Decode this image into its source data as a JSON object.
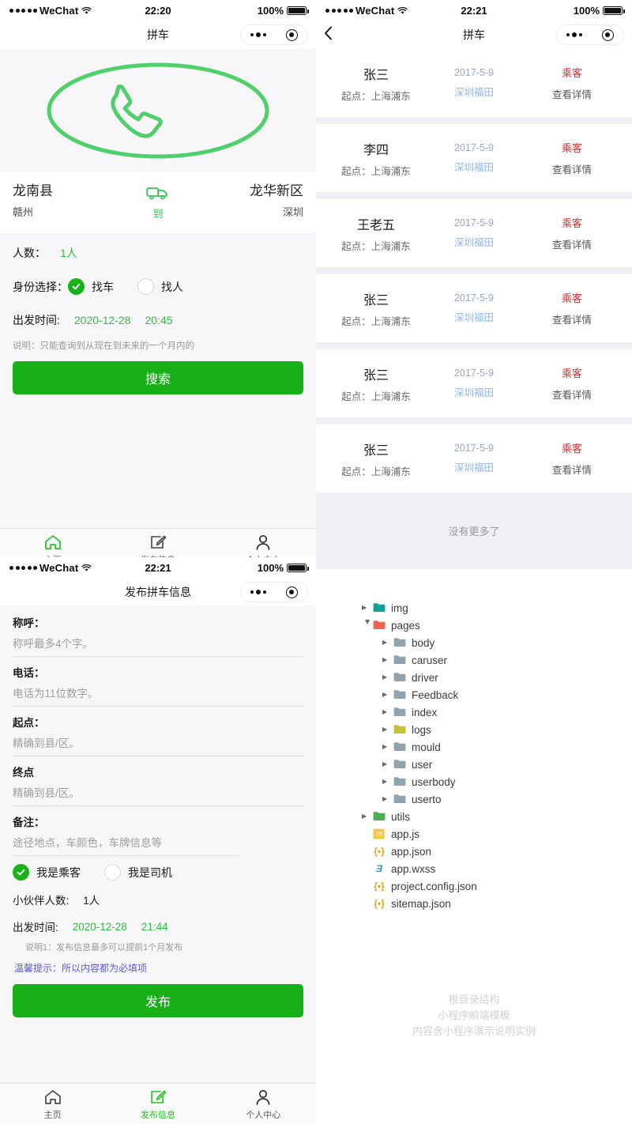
{
  "statusbar": {
    "carrier": "WeChat",
    "time_search": "22:20",
    "time_list": "22:21",
    "time_publish": "22:21",
    "battery": "100%"
  },
  "search_page": {
    "nav_title": "拼车",
    "hero_icon": "phone-call-icon",
    "route": {
      "from_name": "龙南县",
      "from_sub": "赣州",
      "mid_icon": "truck-icon",
      "mid_label": "到",
      "to_name": "龙华新区",
      "to_sub": "深圳"
    },
    "people_label": "人数：",
    "people_value": "1人",
    "identity_label": "身份选择：",
    "identity_options": [
      {
        "label": "找车",
        "selected": true
      },
      {
        "label": "找人",
        "selected": false
      }
    ],
    "depart_label": "出发时间:",
    "depart_date": "2020-12-28",
    "depart_time": "20:45",
    "hint": "说明：只能查询到从现在到未来的一个月内的",
    "search_button": "搜索"
  },
  "tabbar": {
    "home": "主页",
    "publish": "发布信息",
    "profile": "个人中心"
  },
  "list_page": {
    "nav_title": "拼车",
    "back_icon": "chevron-left-icon",
    "rows": [
      {
        "name": "张三",
        "from": "起点：上海浦东",
        "date": "2017-5-9",
        "dest": "深圳福田",
        "role": "乘客",
        "detail": "查看详情"
      },
      {
        "name": "李四",
        "from": "起点：上海浦东",
        "date": "2017-5-9",
        "dest": "深圳福田",
        "role": "乘客",
        "detail": "查看详情"
      },
      {
        "name": "王老五",
        "from": "起点：上海浦东",
        "date": "2017-5-9",
        "dest": "深圳福田",
        "role": "乘客",
        "detail": "查看详情"
      },
      {
        "name": "张三",
        "from": "起点：上海浦东",
        "date": "2017-5-9",
        "dest": "深圳福田",
        "role": "乘客",
        "detail": "查看详情"
      },
      {
        "name": "张三",
        "from": "起点：上海浦东",
        "date": "2017-5-9",
        "dest": "深圳福田",
        "role": "乘客",
        "detail": "查看详情"
      },
      {
        "name": "张三",
        "from": "起点：上海浦东",
        "date": "2017-5-9",
        "dest": "深圳福田",
        "role": "乘客",
        "detail": "查看详情"
      }
    ],
    "no_more": "没有更多了"
  },
  "publish_page": {
    "nav_title": "发布拼车信息",
    "fields": [
      {
        "label": "称呼：",
        "placeholder": "称呼最多4个字。"
      },
      {
        "label": "电话：",
        "placeholder": "电话为11位数字。"
      },
      {
        "label": "起点：",
        "placeholder": "精确到县/区。"
      },
      {
        "label": "终点",
        "placeholder": "精确到县/区。"
      },
      {
        "label": "备注：",
        "placeholder": "途径地点，车颜色，车牌信息等"
      }
    ],
    "role_options": [
      {
        "label": "我是乘客",
        "selected": true
      },
      {
        "label": "我是司机",
        "selected": false
      }
    ],
    "partners_label": "小伙伴人数:",
    "partners_value": "1人",
    "depart_label": "出发时间:",
    "depart_date": "2020-12-28",
    "depart_time": "21:44",
    "note": "说明1：发布信息最多可以提前1个月发布",
    "tip": "温馨提示：所以内容都为必填项",
    "publish_button": "发布"
  },
  "file_tree": {
    "nodes": [
      {
        "name": "img",
        "depth": 1,
        "arrow": "right",
        "icon": "folder-teal",
        "type": "folder"
      },
      {
        "name": "pages",
        "depth": 1,
        "arrow": "down",
        "icon": "folder-red",
        "type": "folder"
      },
      {
        "name": "body",
        "depth": 2,
        "arrow": "right",
        "icon": "folder-gray",
        "type": "folder"
      },
      {
        "name": "caruser",
        "depth": 2,
        "arrow": "right",
        "icon": "folder-gray",
        "type": "folder"
      },
      {
        "name": "driver",
        "depth": 2,
        "arrow": "right",
        "icon": "folder-gray",
        "type": "folder"
      },
      {
        "name": "Feedback",
        "depth": 2,
        "arrow": "right",
        "icon": "folder-gray",
        "type": "folder"
      },
      {
        "name": "index",
        "depth": 2,
        "arrow": "right",
        "icon": "folder-gray",
        "type": "folder"
      },
      {
        "name": "logs",
        "depth": 2,
        "arrow": "right",
        "icon": "folder-olive",
        "type": "folder"
      },
      {
        "name": "mould",
        "depth": 2,
        "arrow": "right",
        "icon": "folder-gray",
        "type": "folder"
      },
      {
        "name": "user",
        "depth": 2,
        "arrow": "right",
        "icon": "folder-gray",
        "type": "folder"
      },
      {
        "name": "userbody",
        "depth": 2,
        "arrow": "right",
        "icon": "folder-gray",
        "type": "folder"
      },
      {
        "name": "userto",
        "depth": 2,
        "arrow": "right",
        "icon": "folder-gray",
        "type": "folder"
      },
      {
        "name": "utils",
        "depth": 1,
        "arrow": "right",
        "icon": "folder-green",
        "type": "folder"
      },
      {
        "name": "app.js",
        "depth": 1,
        "arrow": "none",
        "icon": "js-file",
        "type": "file"
      },
      {
        "name": "app.json",
        "depth": 1,
        "arrow": "none",
        "icon": "json-file",
        "type": "file"
      },
      {
        "name": "app.wxss",
        "depth": 1,
        "arrow": "none",
        "icon": "wxss-file",
        "type": "file"
      },
      {
        "name": "project.config.json",
        "depth": 1,
        "arrow": "none",
        "icon": "json-file",
        "type": "file"
      },
      {
        "name": "sitemap.json",
        "depth": 1,
        "arrow": "none",
        "icon": "json-file",
        "type": "file"
      }
    ],
    "watermark": [
      "根目录结构",
      "小程序前端模板",
      "内容含小程序演示说明实例"
    ]
  },
  "colors": {
    "brand_green": "#17b117",
    "check_green": "#19b319",
    "danger_red": "#ef2b2b",
    "link_blue": "#5b5bd6"
  }
}
